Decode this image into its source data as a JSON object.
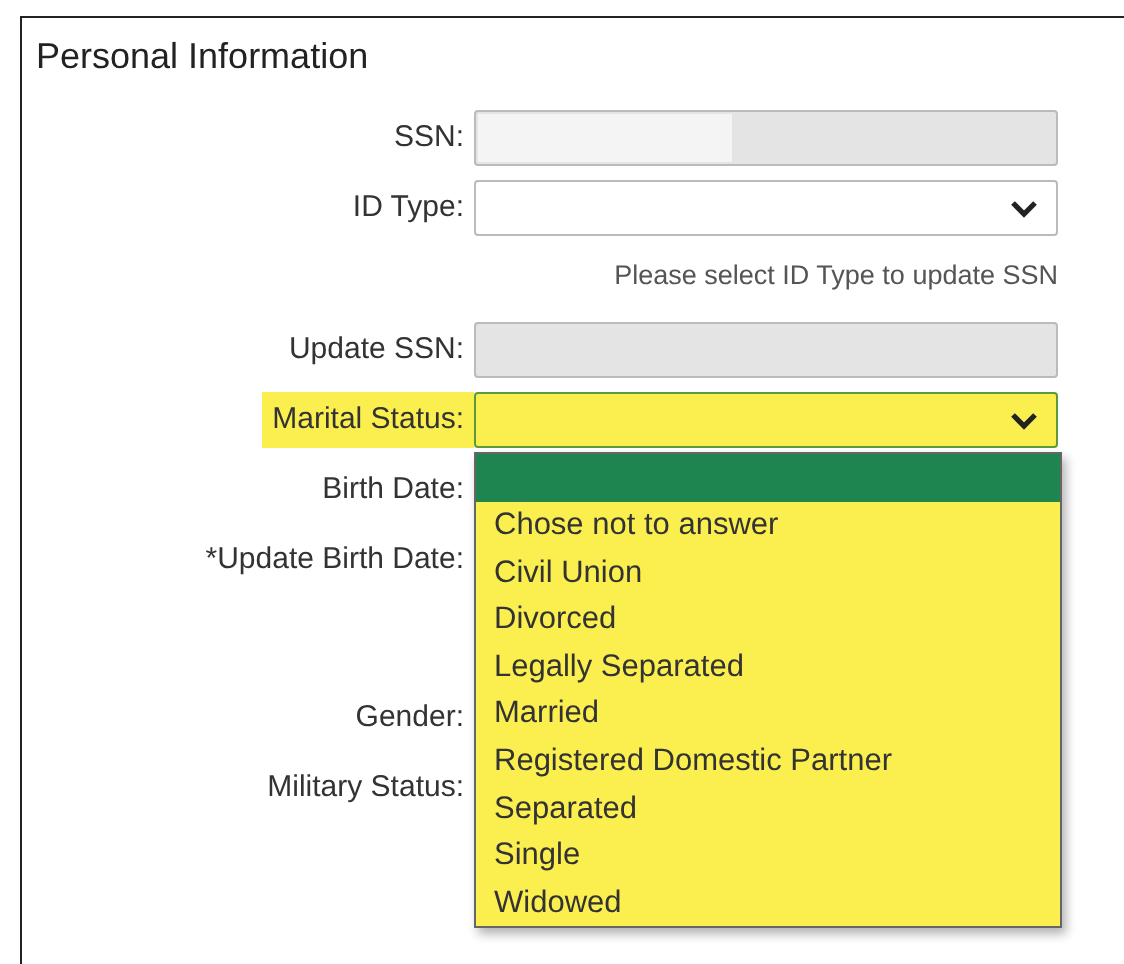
{
  "section": {
    "title": "Personal Information"
  },
  "fields": [
    {
      "kind": "text",
      "label": "SSN:",
      "disabled": true,
      "masked": true,
      "highlighted": false
    },
    {
      "kind": "select",
      "label": "ID Type:",
      "disabled": false,
      "highlighted": false,
      "hint": "Please select ID Type to update SSN"
    },
    {
      "kind": "text",
      "label": "Update SSN:",
      "disabled": true,
      "masked": false,
      "highlighted": false
    },
    {
      "kind": "select",
      "label": "Marital Status:",
      "disabled": false,
      "highlighted": true,
      "expanded": true
    },
    {
      "kind": "covered",
      "label": "Birth Date:",
      "highlighted": false
    },
    {
      "kind": "covered-tall",
      "label": "*Update Birth Date:",
      "highlighted": false
    },
    {
      "kind": "covered",
      "label": "Gender:",
      "highlighted": false
    },
    {
      "kind": "covered",
      "label": "Military Status:",
      "highlighted": false
    }
  ],
  "dropdown": {
    "blank_selected": true,
    "options": [
      {
        "label": "Chose not to answer",
        "selected": false
      },
      {
        "label": "Civil Union",
        "selected": false
      },
      {
        "label": "Divorced",
        "selected": false
      },
      {
        "label": "Legally Separated",
        "selected": false
      },
      {
        "label": "Married",
        "selected": false
      },
      {
        "label": "Registered Domestic Partner",
        "selected": false
      },
      {
        "label": "Separated",
        "selected": false
      },
      {
        "label": "Single",
        "selected": false
      },
      {
        "label": "Widowed",
        "selected": false
      }
    ]
  }
}
